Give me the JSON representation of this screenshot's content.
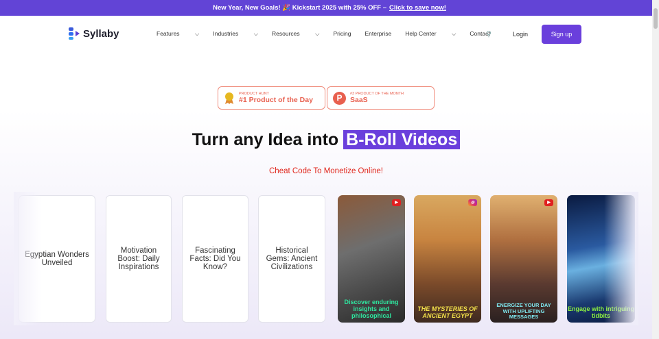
{
  "banner": {
    "text": "New Year, New Goals! 🎉 Kickstart 2025 with 25% OFF –",
    "link": "Click to save now!"
  },
  "nav": {
    "logo": "Syllaby",
    "items": [
      "Features",
      "Industries",
      "Resources",
      "Pricing",
      "Enterprise",
      "Help Center",
      "Contact"
    ],
    "login": "Login",
    "signup": "Sign up"
  },
  "badges": [
    {
      "small": "PRODUCT HUNT",
      "big": "#1 Product of the Day"
    },
    {
      "small": "#3 PRODUCT OF THE MONTH",
      "big": "SaaS"
    }
  ],
  "hero": {
    "title": "Turn any Idea into",
    "highlight": "B-Roll Videos",
    "subtitle": "Cheat Code To Monetize Online!"
  },
  "ideas": [
    "Egyptian Wonders Unveiled",
    "Motivation Boost: Daily Inspirations",
    "Fascinating Facts: Did You Know?",
    "Historical Gems: Ancient Civilizations"
  ],
  "videos": [
    {
      "caption": "Discover enduring insights and philosophical",
      "platform": "youtube",
      "color": "#2ee8a0"
    },
    {
      "caption": "THE MYSTERIES OF ANCIENT EGYPT",
      "platform": "instagram",
      "color": "#f2e04a"
    },
    {
      "caption": "ENERGIZE YOUR DAY WITH UPLIFTING MESSAGES",
      "platform": "youtube",
      "color": "#7fe8f0"
    },
    {
      "caption": "Engage with intriguing tidbits",
      "platform": "",
      "color": "#8cf040"
    }
  ],
  "colors": {
    "accent": "#6a3fdc",
    "badge": "#e8604f",
    "subtitle": "#e0261c"
  }
}
